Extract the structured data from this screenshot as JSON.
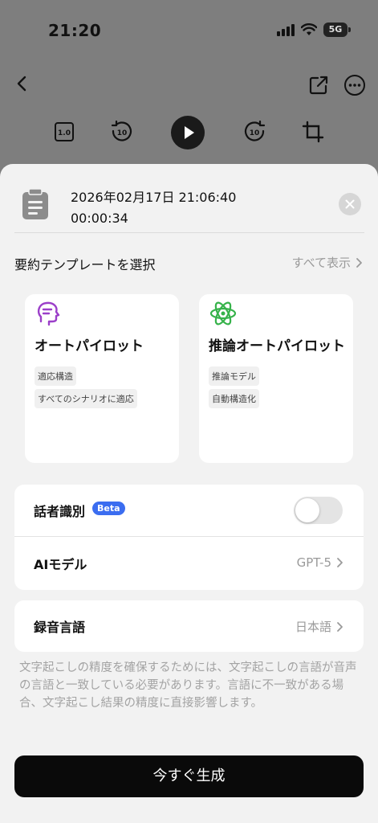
{
  "status_bar": {
    "time": "21:20",
    "network": "5G"
  },
  "header": {
    "back_icon": "chevron-left-icon",
    "share_icon": "share-icon",
    "more_icon": "more-icon"
  },
  "player": {
    "speed_label": "1.0",
    "rewind_label": "10",
    "forward_label": "10"
  },
  "recording": {
    "datetime": "2026年02月17日 21:06:40",
    "duration": "00:00:34"
  },
  "templates": {
    "section_title": "要約テンプレートを選択",
    "show_all": "すべて表示",
    "items": [
      {
        "name": "オートパイロット",
        "icon": "autopilot-head-icon",
        "color": "#9b3fc9",
        "tags": [
          "適応構造",
          "すべてのシナリオに適応"
        ]
      },
      {
        "name": "推論オートパイロット",
        "icon": "atom-icon",
        "color": "#36b24a",
        "tags": [
          "推論モデル",
          "自動構造化"
        ]
      }
    ]
  },
  "settings": {
    "speaker_id": {
      "label": "話者識別",
      "badge": "Beta",
      "enabled": false
    },
    "ai_model": {
      "label": "AIモデル",
      "value": "GPT-5"
    },
    "language": {
      "label": "録音言語",
      "value": "日本語"
    }
  },
  "notice": "文字起こしの精度を確保するためには、文字起こしの言語が音声の言語と一致している必要があります。言語に不一致がある場合、文字起こし結果の精度に直接影響します。",
  "generate_button": "今すぐ生成",
  "colors": {
    "accent": "#3b6df0",
    "primary_button": "#0a0a0a",
    "sheet_bg": "#f2f2f2"
  }
}
